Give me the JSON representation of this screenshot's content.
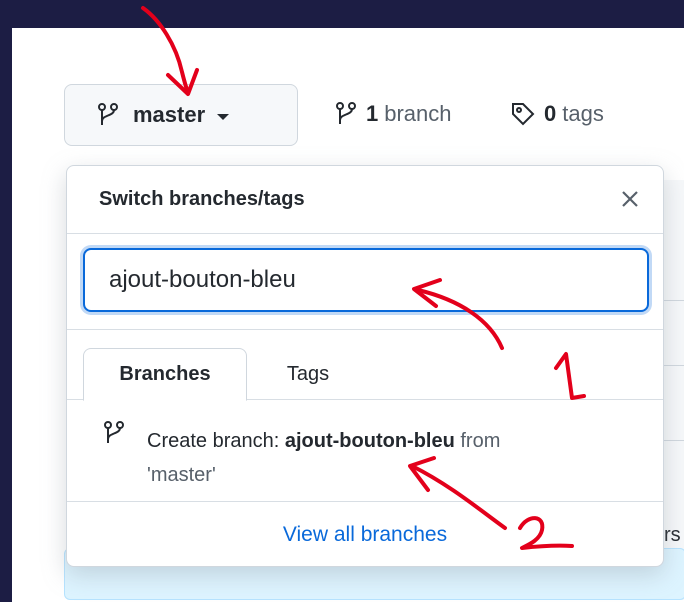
{
  "branch_button": {
    "label": "master"
  },
  "branches_link": {
    "count": "1",
    "label": "branch"
  },
  "tags_link": {
    "count": "0",
    "label": "tags"
  },
  "dropdown": {
    "title": "Switch branches/tags",
    "search_value": "ajout-bouton-bleu",
    "tabs": [
      {
        "label": "Branches",
        "active": true
      },
      {
        "label": "Tags",
        "active": false
      }
    ],
    "create": {
      "prefix": "Create branch: ",
      "branch_name": "ajout-bouton-bleu",
      "from_word": " from",
      "source": "'master'"
    },
    "footer_link": "View all branches"
  },
  "background": {
    "partial_text": "rs"
  },
  "annotations": {
    "label_1": "1",
    "label_2": "2",
    "color": "#e3001b"
  },
  "colors": {
    "accent": "#0969da",
    "page_bg": "#1c1d44"
  }
}
